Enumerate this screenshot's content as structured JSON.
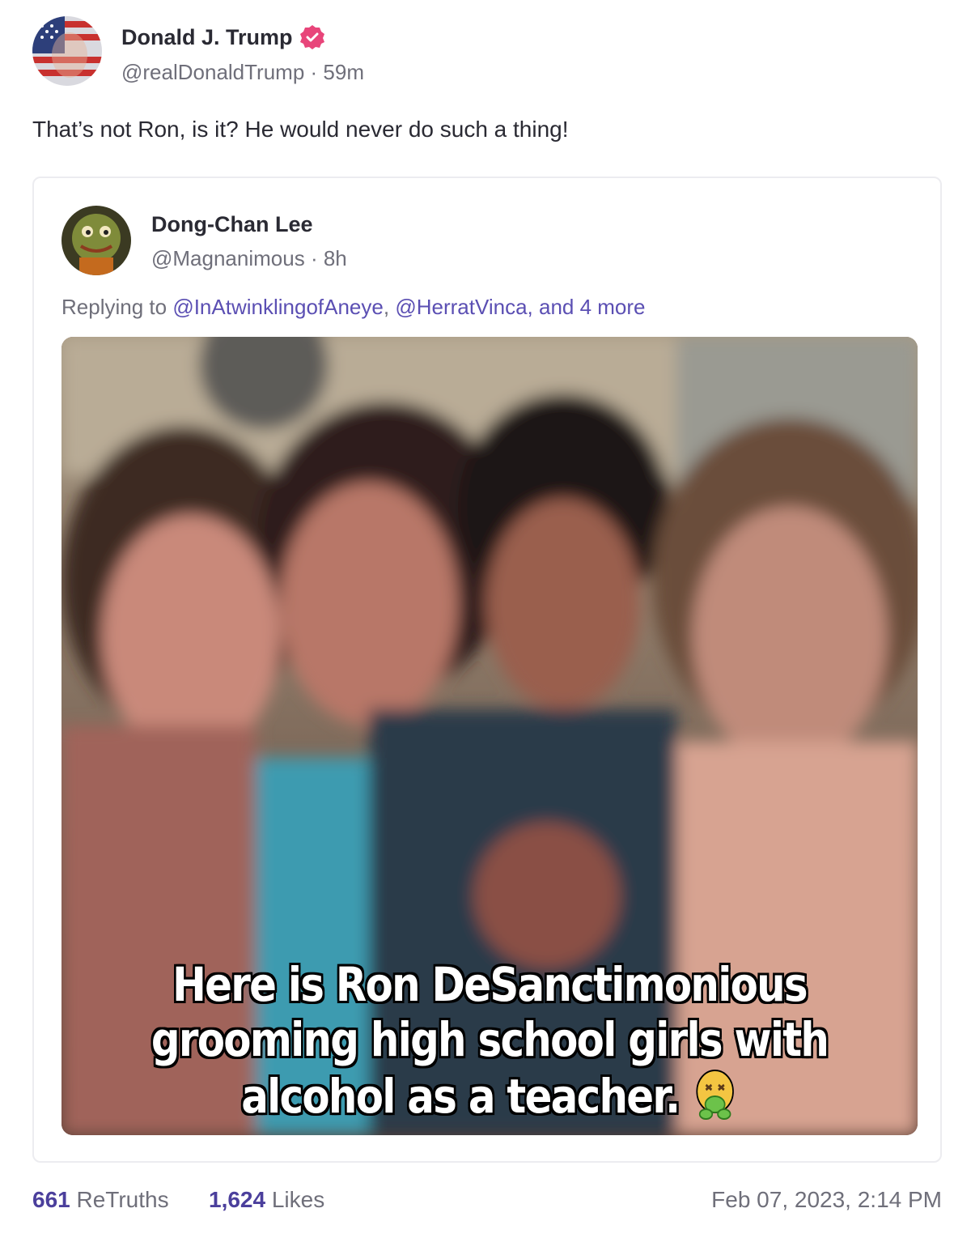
{
  "post": {
    "author_name": "Donald J. Trump",
    "author_handle": "@realDonaldTrump",
    "time_ago": "59m",
    "text": "That’s not Ron, is it? He would never do such a thing!",
    "verified_icon": "verified-badge-icon",
    "verified_color": "#e8457a"
  },
  "quoted": {
    "author_name": "Dong-Chan Lee",
    "author_handle": "@Magnanimous",
    "time_ago": "8h",
    "reply_prefix": "Replying to",
    "reply_user_1": "@InAtwinklingofAneye",
    "reply_sep": ",",
    "reply_user_2": "@HerratVinca",
    "reply_suffix": ", and 4 more",
    "image_caption_lines": [
      "Here is Ron DeSanctimonious",
      "grooming high school girls with",
      "alcohol as a teacher."
    ],
    "caption_emoji": "nauseated-face-icon"
  },
  "footer": {
    "retruths_count": "661",
    "retruths_label": "ReTruths",
    "likes_count": "1,624",
    "likes_label": "Likes",
    "timestamp": "Feb 07, 2023, 2:14 PM"
  },
  "colors": {
    "link": "#5b4fb3",
    "stat_number": "#4b3f9c",
    "muted_text": "#6f6f7a"
  }
}
